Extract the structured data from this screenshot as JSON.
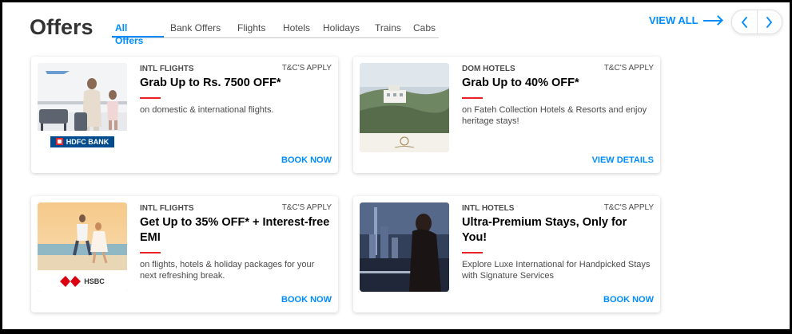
{
  "header": {
    "title": "Offers",
    "tabs": [
      {
        "label": "All Offers",
        "active": true
      },
      {
        "label": "Bank Offers"
      },
      {
        "label": "Flights"
      },
      {
        "label": "Hotels"
      },
      {
        "label": "Holidays"
      },
      {
        "label": "Trains"
      },
      {
        "label": "Cabs"
      }
    ],
    "view_all": "VIEW ALL",
    "prev_icon": "chevron-left-icon",
    "next_icon": "chevron-right-icon"
  },
  "offers": [
    {
      "category": "INTL FLIGHTS",
      "tnc": "T&C'S APPLY",
      "headline": "Grab Up to Rs. 7500 OFF*",
      "description": "on domestic & international flights.",
      "cta": "BOOK NOW",
      "bank_logo": "HDFC BANK"
    },
    {
      "category": "DOM HOTELS",
      "tnc": "T&C'S APPLY",
      "headline": "Grab Up to 40% OFF*",
      "description": "on Fateh Collection Hotels & Resorts and enjoy heritage stays!",
      "cta": "VIEW DETAILS"
    },
    {
      "category": "INTL FLIGHTS",
      "tnc": "T&C'S APPLY",
      "headline": "Get Up to 35% OFF* + Interest-free EMI",
      "description": "on flights, hotels & holiday packages for your next refreshing break.",
      "cta": "BOOK NOW",
      "bank_logo": "HSBC"
    },
    {
      "category": "INTL HOTELS",
      "tnc": "T&C'S APPLY",
      "headline": "Ultra-Premium Stays, Only for You!",
      "description": "Explore Luxe International for Handpicked Stays with Signature Services",
      "cta": "BOOK NOW"
    }
  ],
  "colors": {
    "accent": "#008cff",
    "divider_red": "#eb2026",
    "hdfc_blue": "#004c8f",
    "hsbc_red": "#db0011"
  }
}
